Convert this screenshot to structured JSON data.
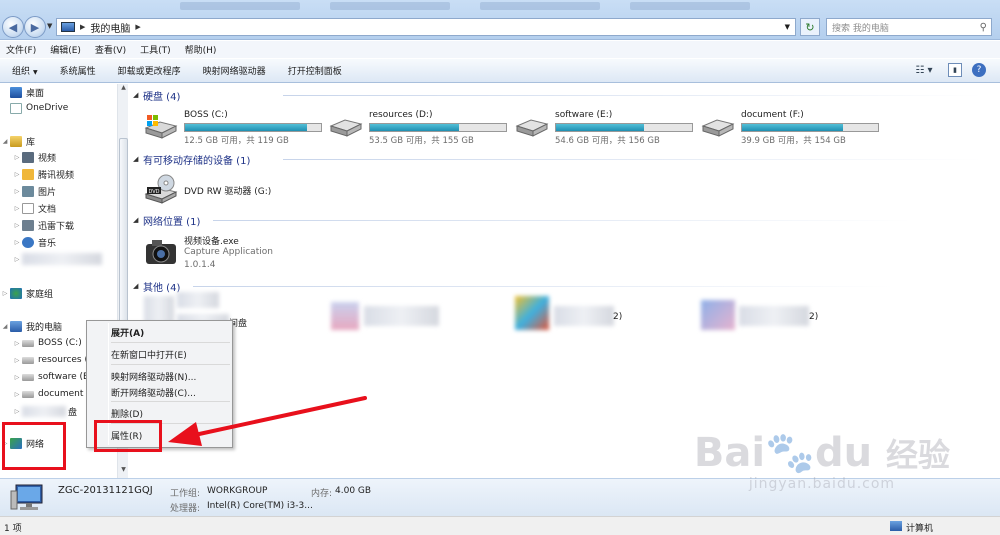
{
  "address": {
    "breadcrumb": "我的电脑",
    "search_placeholder": "搜索 我的电脑"
  },
  "menu": [
    "文件(F)",
    "编辑(E)",
    "查看(V)",
    "工具(T)",
    "帮助(H)"
  ],
  "toolbar": [
    "组织",
    "系统属性",
    "卸载或更改程序",
    "映射网络驱动器",
    "打开控制面板"
  ],
  "nav": {
    "favorites": [
      "桌面",
      "OneDrive"
    ],
    "library": {
      "label": "库",
      "items": [
        "视频",
        "腾讯视频",
        "图片",
        "文档",
        "迅雷下载",
        "音乐"
      ]
    },
    "homegroup": "家庭组",
    "computer": {
      "label": "我的电脑",
      "items": [
        "BOSS (C:)",
        "resources (",
        "software (E",
        "document (",
        "盘"
      ]
    },
    "network": "网络"
  },
  "groups": {
    "hdd": "硬盘 (4)",
    "removable": "有可移动存储的设备 (1)",
    "netloc": "网络位置 (1)",
    "other": "其他 (4)"
  },
  "drives": [
    {
      "name": "BOSS (C:)",
      "info": "12.5 GB 可用，共 119 GB",
      "used": 0.895
    },
    {
      "name": "resources (D:)",
      "info": "53.5 GB 可用，共 155 GB",
      "used": 0.655
    },
    {
      "name": "software (E:)",
      "info": "54.6 GB 可用，共 156 GB",
      "used": 0.65
    },
    {
      "name": "document (F:)",
      "info": "39.9 GB 可用，共 154 GB",
      "used": 0.74
    }
  ],
  "dvd": {
    "name": "DVD RW 驱动器 (G:)",
    "label": "DVD"
  },
  "netitem": {
    "name": "视频设备.exe",
    "desc": "Capture Application",
    "version": "1.0.1.4"
  },
  "other_fragments": [
    "间盘",
    "2)",
    "2)"
  ],
  "details": {
    "computer_name": "ZGC-20131121GQJ",
    "workgroup_label": "工作组:",
    "workgroup": "WORKGROUP",
    "memory_label": "内存:",
    "memory": "4.00 GB",
    "cpu_label": "处理器:",
    "cpu": "Intel(R) Core(TM) i3-3..."
  },
  "status": {
    "count": "1 项",
    "location": "计算机"
  },
  "context_menu": [
    "展开(A)",
    "在新窗口中打开(E)",
    "映射网络驱动器(N)...",
    "断开网络驱动器(C)...",
    "删除(D)",
    "属性(R)"
  ],
  "watermark": {
    "brand": "Bai",
    "brand2": "du",
    "cn": "经验",
    "url": "jingyan.baidu.com"
  }
}
